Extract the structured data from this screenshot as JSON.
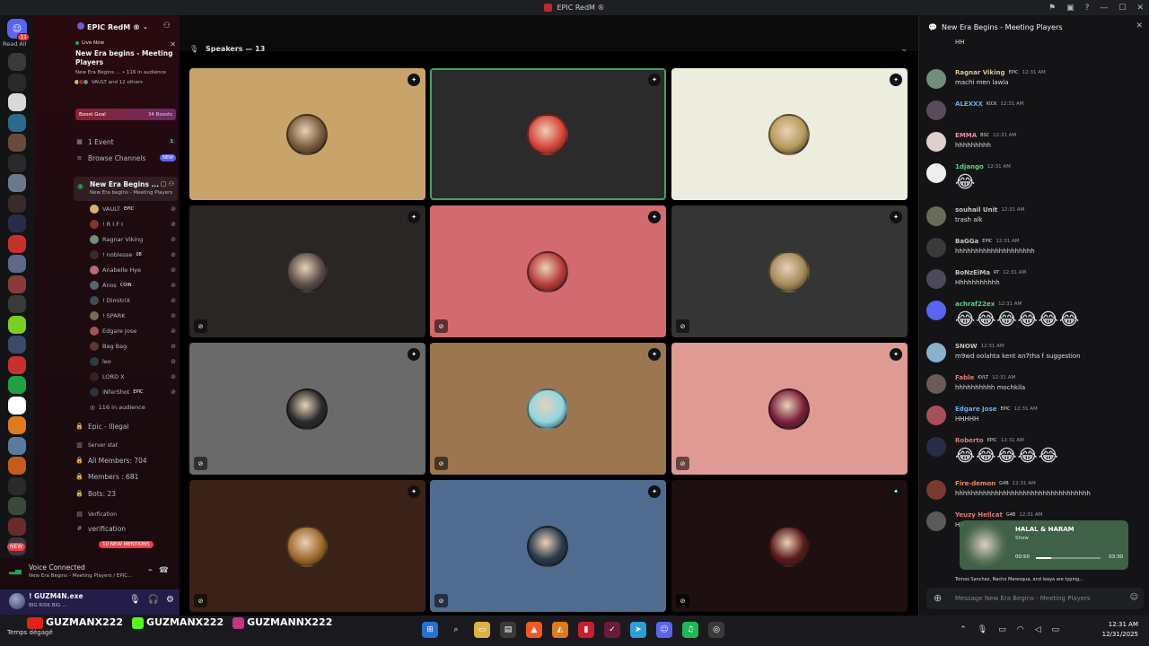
{
  "titlebar": {
    "title": "EPIC RedM ®"
  },
  "guilds": {
    "read_all": "Read All",
    "home_badge": "11",
    "new_label": "NEW"
  },
  "server": {
    "name": "EPIC RedM ®"
  },
  "live": {
    "label": "Live Now",
    "title": "New Era begins - Meeting Players",
    "sub": "New Era Begins ... • 116 in audience",
    "people": "VAULT and 12 others"
  },
  "boost": {
    "label": "Boost Goal",
    "count": "34 Boosts"
  },
  "channels": {
    "events": "1 Event",
    "events_count": "1",
    "browse": "Browse Channels",
    "browse_new": "NEW",
    "vc_name": "New Era Begins ...",
    "vc_sub": "New Era begins - Meeting Players",
    "users": [
      {
        "name": "VAULT",
        "tag": "EPIC",
        "color": "#d8b26e"
      },
      {
        "name": "! R I F I",
        "tag": "",
        "color": "#8c2f2f"
      },
      {
        "name": "Ragnar Viking",
        "tag": "",
        "color": "#6f8f7a"
      },
      {
        "name": "! noblesse",
        "tag": "08",
        "color": "#3b2a2a"
      },
      {
        "name": "Anabelle Hye",
        "tag": "",
        "color": "#b56c7a"
      },
      {
        "name": "Anos",
        "tag": "COIN",
        "color": "#5a6270"
      },
      {
        "name": "! DimitriX",
        "tag": "",
        "color": "#444a55"
      },
      {
        "name": "! SPARK",
        "tag": "",
        "color": "#7a6a5a"
      },
      {
        "name": "Edgare Jose",
        "tag": "",
        "color": "#a84f5a"
      },
      {
        "name": "Bag Bag",
        "tag": "",
        "color": "#5a3a30"
      },
      {
        "name": "leo",
        "tag": "",
        "color": "#2f3a4a"
      },
      {
        "name": "LORD X",
        "tag": "",
        "color": "#3a2020"
      },
      {
        "name": "iNferShot",
        "tag": "EPIC",
        "color": "#30303a"
      }
    ],
    "audience": "116 in audience",
    "illegal": "Epic - Illegal",
    "server_stat": "Server stat",
    "all_members": "All Members: 704",
    "members": "Members : 681",
    "bots": "Bots: 23",
    "verification_cat": "Verfication",
    "verification": "verification",
    "mentions": "10 NEW MENTIONS"
  },
  "voice": {
    "connected": "Voice Connected",
    "sub": "New Era Begins - Meeting Players / EPIC..."
  },
  "user": {
    "name": "! GUZM4N.exe",
    "status": "BIG RISK BIG ..."
  },
  "stage": {
    "label": "Speakers — 13",
    "tiles": [
      {
        "bg": "#c8a46b",
        "av": "#7a5a3a",
        "speaking": false,
        "muted": false
      },
      {
        "bg": "#2b2b2b",
        "av": "#d8443a",
        "speaking": true,
        "muted": false
      },
      {
        "bg": "#ececdf",
        "av": "#b89a5a",
        "speaking": false,
        "muted": false
      },
      {
        "bg": "#2a2626",
        "av": "#5a4a48",
        "speaking": false,
        "muted": true
      },
      {
        "bg": "#d36a6f",
        "av": "#b83a3a",
        "speaking": false,
        "muted": true
      },
      {
        "bg": "#353535",
        "av": "#a58a5a",
        "speaking": false,
        "muted": true
      },
      {
        "bg": "#6a6a6a",
        "av": "#2a2a2a",
        "speaking": false,
        "muted": true
      },
      {
        "bg": "#9c7650",
        "av": "#8fd8e0",
        "speaking": false,
        "muted": true
      },
      {
        "bg": "#de9a93",
        "av": "#7a1f3a",
        "speaking": false,
        "muted": true
      },
      {
        "bg": "#3a2218",
        "av": "#a06a2a",
        "speaking": false,
        "muted": true
      },
      {
        "bg": "#4f6b8f",
        "av": "#2a3a4a",
        "speaking": false,
        "muted": true
      },
      {
        "bg": "#1e0f10",
        "av": "#5a1a1a",
        "speaking": false,
        "muted": true
      }
    ]
  },
  "chat": {
    "title": "New Era Begins - Meeting Players",
    "top_text": "HH",
    "messages": [
      {
        "name": "Ragnar Viking",
        "tag": "EPIC",
        "time": "12:31 AM",
        "text": "machi men lawla",
        "color": "#d7c29a",
        "av": "#6f8f7a",
        "emoji": false
      },
      {
        "name": "ALEXXX",
        "tag": "KICK",
        "time": "12:31 AM",
        "text": "",
        "color": "#5fb2f0",
        "av": "#5a4a5a",
        "emoji": false
      },
      {
        "name": "EMMA",
        "tag": "BSC",
        "time": "12:31 AM",
        "text": "hhhhhhhhh",
        "color": "#f08aa6",
        "av": "#e0cfcf",
        "emoji": false
      },
      {
        "name": "1django",
        "tag": "",
        "time": "12:31 AM",
        "text": "😂",
        "color": "#5fd08a",
        "av": "#eee",
        "emoji": true
      },
      {
        "name": "souhail Unit",
        "tag": "",
        "time": "12:31 AM",
        "text": "trash alk",
        "color": "#c4c4c4",
        "av": "#6a6a58",
        "emoji": false
      },
      {
        "name": "BaGGa",
        "tag": "EPIC",
        "time": "12:31 AM",
        "text": "hhhhhhhhhhhhhhhhhhhh",
        "color": "#c4c4c4",
        "av": "#3a3a3a",
        "emoji": false
      },
      {
        "name": "BoNzEiMa",
        "tag": "RT",
        "time": "12:31 AM",
        "text": "Hhhhhhhhhhh",
        "color": "#c4c4c4",
        "av": "#4a4a5a",
        "emoji": false
      },
      {
        "name": "achraf22ex",
        "tag": "",
        "time": "12:31 AM",
        "text": "😂😂😂😂😂😂",
        "color": "#5fd08a",
        "av": "#5865f2",
        "emoji": true
      },
      {
        "name": "SNOW",
        "tag": "",
        "time": "12:31 AM",
        "text": "m9wd oolahta kent an7tha f suggestion",
        "color": "#c4c4c4",
        "av": "#8ab0d0",
        "emoji": false
      },
      {
        "name": "Fable",
        "tag": "KVLT",
        "time": "12:31 AM",
        "text": "hhhhhhhhhh mochkila",
        "color": "#e07a7a",
        "av": "#6a5a5a",
        "emoji": false
      },
      {
        "name": "Edgare Jose",
        "tag": "EPIC",
        "time": "12:31 AM",
        "text": "HHHHH",
        "color": "#5fb2f0",
        "av": "#a84f5a",
        "emoji": false
      },
      {
        "name": "Roberto",
        "tag": "EPIC",
        "time": "12:31 AM",
        "text": "😂😂😂😂😂",
        "color": "#e07a7a",
        "av": "#2a2a4a",
        "emoji": true
      },
      {
        "name": "Fire-demon",
        "tag": "G4B",
        "time": "12:31 AM",
        "text": "hhhhhhhhhhhhhhhhhhhhhhhhhhhhhhhhhh",
        "color": "#f08a5a",
        "av": "#7a3a2a",
        "emoji": false
      },
      {
        "name": "Yeuzy Hellcat",
        "tag": "G4B",
        "time": "12:31 AM",
        "text": "Hh",
        "color": "#e07a7a",
        "av": "#5a5a5a",
        "emoji": false
      }
    ],
    "music": {
      "title": "HALAL & HARAM",
      "sub": "Show",
      "elapsed": "00:50",
      "total": "03:30",
      "progress": 0.24
    },
    "typing": "Tomas Sanchez, Nacho Maresqua, and leaya are typing...",
    "composer_placeholder": "Message New Era Begins - Meeting Players"
  },
  "overlay": {
    "handles": [
      "GUZMANX222",
      "GUZMANX222",
      "GUZMANNX222"
    ],
    "weather": "Temps dégagé"
  },
  "taskbar": {
    "time": "12:31 AM",
    "date": "12/31/2025"
  }
}
